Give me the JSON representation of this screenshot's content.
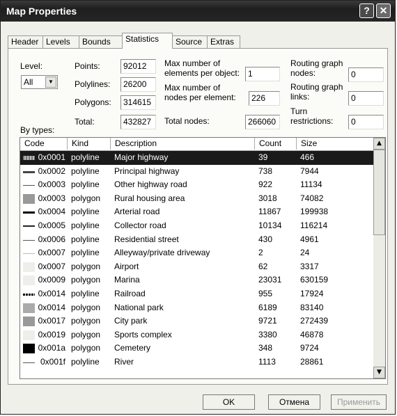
{
  "window": {
    "title": "Map Properties"
  },
  "tabs": [
    {
      "label": "Header"
    },
    {
      "label": "Levels"
    },
    {
      "label": "Bounds"
    },
    {
      "label": "Statistics"
    },
    {
      "label": "Source"
    },
    {
      "label": "Extras"
    }
  ],
  "stats": {
    "level_label": "Level:",
    "level_value": "All",
    "points_label": "Points:",
    "points_value": "92012",
    "polylines_label": "Polylines:",
    "polylines_value": "26200",
    "polygons_label": "Polygons:",
    "polygons_value": "314615",
    "total_label": "Total:",
    "total_value": "432827",
    "max_elements_label_1": "Max number of",
    "max_elements_label_2": "elements per object:",
    "max_elements_value": "1",
    "max_nodes_label_1": "Max number of",
    "max_nodes_label_2": "nodes per element:",
    "max_nodes_value": "226",
    "total_nodes_label": "Total nodes:",
    "total_nodes_value": "266060",
    "rg_nodes_label_1": "Routing graph",
    "rg_nodes_label_2": "nodes:",
    "rg_nodes_value": "0",
    "rg_links_label_1": "Routing graph",
    "rg_links_label_2": "links:",
    "rg_links_value": "0",
    "turn_label_1": "Turn",
    "turn_label_2": "restrictions:",
    "turn_value": "0",
    "by_types_label": "By types:"
  },
  "table": {
    "columns": [
      "Code",
      "Kind",
      "Description",
      "Count",
      "Size"
    ],
    "rows": [
      {
        "swatch": "hatch",
        "code": "0x0001",
        "kind": "polyline",
        "description": "Major highway",
        "count": "39",
        "size": "466"
      },
      {
        "swatch": "thick",
        "code": "0x0002",
        "kind": "polyline",
        "description": "Principal highway",
        "count": "738",
        "size": "7944"
      },
      {
        "swatch": "thin",
        "code": "0x0003",
        "kind": "polyline",
        "description": "Other highway road",
        "count": "922",
        "size": "11134"
      },
      {
        "swatch": "gray",
        "code": "0x0003",
        "kind": "polygon",
        "description": "Rural housing area",
        "count": "3018",
        "size": "74082"
      },
      {
        "swatch": "black-line",
        "code": "0x0004",
        "kind": "polyline",
        "description": "Arterial road",
        "count": "11867",
        "size": "199938"
      },
      {
        "swatch": "medium",
        "code": "0x0005",
        "kind": "polyline",
        "description": "Collector road",
        "count": "10134",
        "size": "116214"
      },
      {
        "swatch": "thin",
        "code": "0x0006",
        "kind": "polyline",
        "description": "Residential street",
        "count": "430",
        "size": "4961"
      },
      {
        "swatch": "faint",
        "code": "0x0007",
        "kind": "polyline",
        "description": "Alleyway/private driveway",
        "count": "2",
        "size": "24"
      },
      {
        "swatch": "light",
        "code": "0x0007",
        "kind": "polygon",
        "description": "Airport",
        "count": "62",
        "size": "3317"
      },
      {
        "swatch": "light",
        "code": "0x0009",
        "kind": "polygon",
        "description": "Marina",
        "count": "23031",
        "size": "630159"
      },
      {
        "swatch": "rail",
        "code": "0x0014",
        "kind": "polyline",
        "description": "Railroad",
        "count": "955",
        "size": "17924"
      },
      {
        "swatch": "gray-light",
        "code": "0x0014",
        "kind": "polygon",
        "description": "National park",
        "count": "6189",
        "size": "83140"
      },
      {
        "swatch": "gray",
        "code": "0x0017",
        "kind": "polygon",
        "description": "City park",
        "count": "9721",
        "size": "272439"
      },
      {
        "swatch": "light",
        "code": "0x0019",
        "kind": "polygon",
        "description": "Sports complex",
        "count": "3380",
        "size": "46878"
      },
      {
        "swatch": "black",
        "code": "0x001a",
        "kind": "polygon",
        "description": "Cemetery",
        "count": "348",
        "size": "9724"
      },
      {
        "swatch": "thin",
        "code": "0x001f",
        "kind": "polyline",
        "description": "River",
        "count": "1113",
        "size": "28861"
      }
    ]
  },
  "buttons": {
    "ok": "OK",
    "cancel": "Отмена",
    "apply": "Применить"
  },
  "icons": {
    "help": "question-mark",
    "close": "x-mark",
    "dropdown": "triangle-down",
    "scroll_up": "triangle-up",
    "scroll_down": "triangle-down"
  },
  "colors": {
    "titlebar": "#262626",
    "selection": "#1a1a1a",
    "panel": "#fbfbf7"
  }
}
